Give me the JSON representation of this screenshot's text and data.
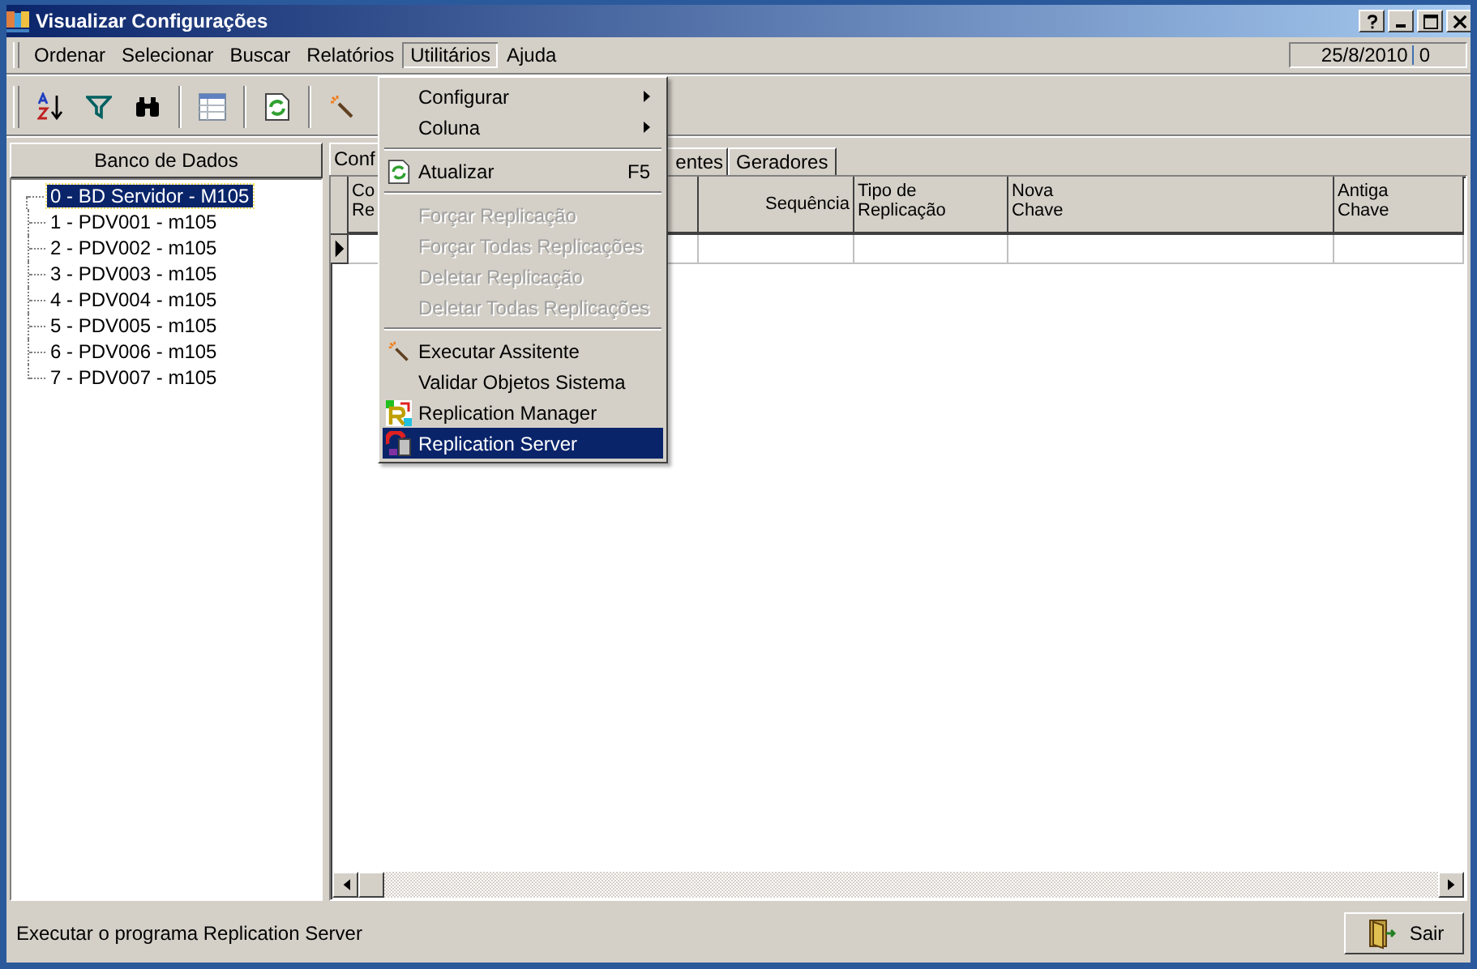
{
  "window": {
    "title": "Visualizar Configurações"
  },
  "menu_bar": [
    {
      "label": "Ordenar",
      "selected": false
    },
    {
      "label": "Selecionar",
      "selected": false
    },
    {
      "label": "Buscar",
      "selected": false
    },
    {
      "label": "Relatórios",
      "selected": false
    },
    {
      "label": "Utilitários",
      "selected": true
    },
    {
      "label": "Ajuda",
      "selected": false
    }
  ],
  "date_panel": {
    "date": "25/8/2010",
    "count": "0"
  },
  "sidebar": {
    "header": "Banco de Dados",
    "items": [
      {
        "label": "0 - BD Servidor - M105",
        "selected": true
      },
      {
        "label": "1 - PDV001 - m105",
        "selected": false
      },
      {
        "label": "2 - PDV002 - m105",
        "selected": false
      },
      {
        "label": "3 - PDV003 - m105",
        "selected": false
      },
      {
        "label": "4 - PDV004 - m105",
        "selected": false
      },
      {
        "label": "5 - PDV005 - m105",
        "selected": false
      },
      {
        "label": "6 - PDV006 - m105",
        "selected": false
      },
      {
        "label": "7 - PDV007 - m105",
        "selected": false
      }
    ]
  },
  "tabs": [
    {
      "label": "Conf",
      "selected": true
    },
    {
      "label": "entes",
      "selected": false
    },
    {
      "label": "Geradores",
      "selected": false
    }
  ],
  "table": {
    "columns": [
      {
        "lines": [
          "Co",
          "Re"
        ]
      },
      {
        "lines": [
          "Sequência"
        ]
      },
      {
        "lines": [
          "Tipo de",
          "Replicação"
        ]
      },
      {
        "lines": [
          "Nova",
          "Chave"
        ]
      },
      {
        "lines": [
          "Antiga",
          "Chave"
        ]
      }
    ]
  },
  "dropdown_menu": [
    {
      "kind": "submenu",
      "label": "Configurar",
      "disabled": false,
      "selected": false
    },
    {
      "kind": "submenu",
      "label": "Coluna",
      "disabled": false,
      "selected": false
    },
    {
      "kind": "separator"
    },
    {
      "kind": "item",
      "label": "Atualizar",
      "shortcut": "F5",
      "disabled": false,
      "selected": false
    },
    {
      "kind": "separator"
    },
    {
      "kind": "item",
      "label": "Forçar Replicação",
      "disabled": true,
      "selected": false
    },
    {
      "kind": "item",
      "label": "Forçar Todas Replicações",
      "disabled": true,
      "selected": false
    },
    {
      "kind": "item",
      "label": "Deletar Replicação",
      "disabled": true,
      "selected": false
    },
    {
      "kind": "item",
      "label": "Deletar Todas Replicações",
      "disabled": true,
      "selected": false
    },
    {
      "kind": "separator"
    },
    {
      "kind": "item",
      "label": "Executar Assitente",
      "disabled": false,
      "selected": false
    },
    {
      "kind": "item",
      "label": "Validar Objetos Sistema",
      "disabled": false,
      "selected": false
    },
    {
      "kind": "item",
      "label": "Replication Manager",
      "disabled": false,
      "selected": false
    },
    {
      "kind": "item",
      "label": "Replication Server",
      "disabled": false,
      "selected": true
    }
  ],
  "status_bar": {
    "text": "Executar o programa Replication Server",
    "button": "Sair"
  }
}
